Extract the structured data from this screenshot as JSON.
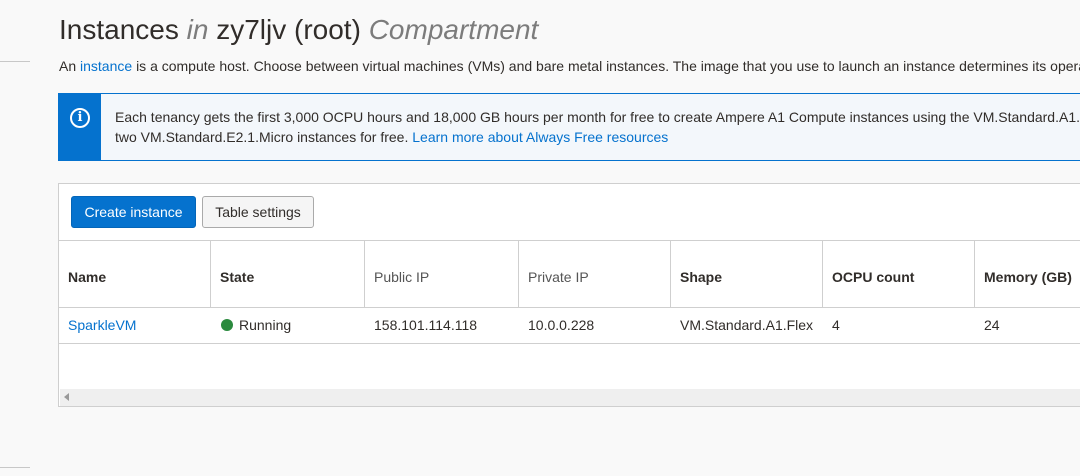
{
  "page": {
    "title_main": "Instances",
    "title_in": "in",
    "title_compartment_name": "zy7ljv (root)",
    "title_compartment": "Compartment",
    "desc_prefix": "An",
    "desc_link": "instance",
    "desc_rest": "is a compute host. Choose between virtual machines (VMs) and bare metal instances. The image that you use to launch an instance determines its opera"
  },
  "info": {
    "icon": "info-circle-icon",
    "line1": "Each tenancy gets the first 3,000 OCPU hours and 18,000 GB hours per month for free to create Ampere A1 Compute instances using the VM.Standard.A1.",
    "line2_text": "two VM.Standard.E2.1.Micro instances for free.",
    "line2_link": "Learn more about Always Free resources"
  },
  "toolbar": {
    "create_label": "Create instance",
    "settings_label": "Table settings"
  },
  "table": {
    "columns": [
      "Name",
      "State",
      "Public IP",
      "Private IP",
      "Shape",
      "OCPU count",
      "Memory (GB)"
    ],
    "rows": [
      {
        "name": "SparkleVM",
        "state": "Running",
        "public_ip": "158.101.114.118",
        "private_ip": "10.0.0.228",
        "shape": "VM.Standard.A1.Flex",
        "ocpu": "4",
        "memory": "24"
      }
    ]
  },
  "colors": {
    "accent": "#0572ce",
    "running": "#2b8a3e"
  }
}
